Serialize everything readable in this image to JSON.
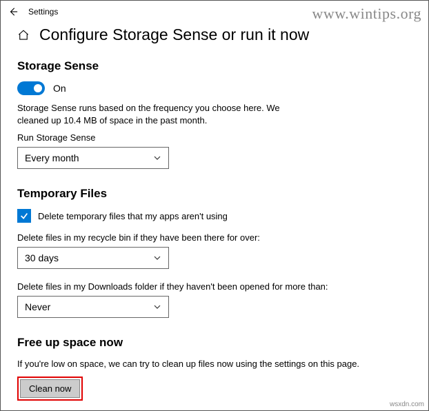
{
  "topbar": {
    "app_label": "Settings"
  },
  "title": "Configure Storage Sense or run it now",
  "storage_sense": {
    "heading": "Storage Sense",
    "toggle_state": "On",
    "description": "Storage Sense runs based on the frequency you choose here. We cleaned up 10.4 MB of space in the past month.",
    "run_label": "Run Storage Sense",
    "run_value": "Every month"
  },
  "temp_files": {
    "heading": "Temporary Files",
    "checkbox_label": "Delete temporary files that my apps aren't using",
    "checkbox_checked": true,
    "recycle_label": "Delete files in my recycle bin if they have been there for over:",
    "recycle_value": "30 days",
    "downloads_label": "Delete files in my Downloads folder if they haven't been opened for more than:",
    "downloads_value": "Never"
  },
  "free_up": {
    "heading": "Free up space now",
    "description": "If you're low on space, we can try to clean up files now using the settings on this page.",
    "button": "Clean now"
  },
  "watermark": "www.wintips.org",
  "source": "wsxdn.com"
}
